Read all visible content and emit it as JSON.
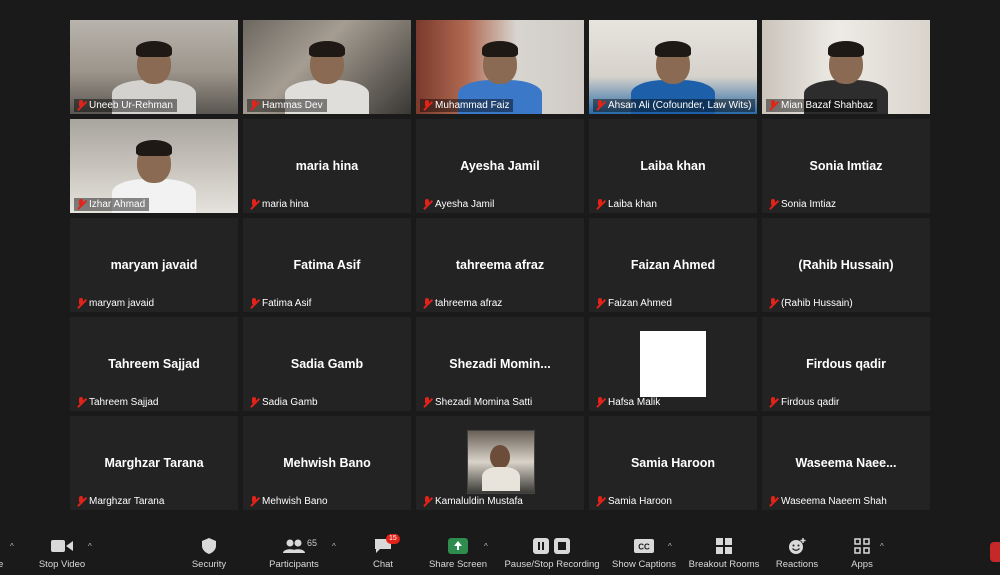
{
  "participants": [
    {
      "name": "Uneeb Ur-Rehman",
      "video": true,
      "bg": "bg-photo1",
      "shirt": "#d4d2cf"
    },
    {
      "name": "Hammas Dev",
      "video": true,
      "bg": "bg-photo2",
      "shirt": "#e0dedb"
    },
    {
      "name": "Muhammad Faiz",
      "video": true,
      "bg": "bg-photo3",
      "shirt": "#3c78c8"
    },
    {
      "name": "Ahsan Ali (Cofounder, Law Wits)",
      "video": true,
      "active": true,
      "bg": "bg-photo4",
      "shirt": "#1d5fa8"
    },
    {
      "name": "Mian Bazaf Shahbaz",
      "video": true,
      "bg": "bg-photo5",
      "shirt": "#2d2d2d"
    },
    {
      "name": "Izhar Ahmad",
      "video": true,
      "bg": "bg-photo6",
      "shirt": "#f2f2f2"
    },
    {
      "name": "maria hina",
      "display": "maria hina"
    },
    {
      "name": "Ayesha Jamil",
      "display": "Ayesha Jamil"
    },
    {
      "name": "Laiba khan",
      "display": "Laiba khan"
    },
    {
      "name": "Sonia Imtiaz",
      "display": "Sonia Imtiaz"
    },
    {
      "name": "maryam javaid",
      "display": "maryam javaid"
    },
    {
      "name": "Fatima Asif",
      "display": "Fatima Asif"
    },
    {
      "name": "tahreema afraz",
      "display": "tahreema afraz"
    },
    {
      "name": "Faizan Ahmed",
      "display": "Faizan Ahmed"
    },
    {
      "name": "(Rahib Hussain)",
      "display": "(Rahib Hussain)"
    },
    {
      "name": "Tahreem Sajjad",
      "display": "Tahreem Sajjad"
    },
    {
      "name": "Sadia Gamb",
      "display": "Sadia Gamb"
    },
    {
      "name": "Shezadi Momina Satti",
      "display": "Shezadi  Momin..."
    },
    {
      "name": "Hafsa Malik",
      "avatar": "white"
    },
    {
      "name": "Firdous qadir",
      "display": "Firdous qadir"
    },
    {
      "name": "Marghzar Tarana",
      "display": "Marghzar Tarana"
    },
    {
      "name": "Mehwish Bano",
      "display": "Mehwish Bano"
    },
    {
      "name": "Kamaluldin Mustafa",
      "avatar": "photo"
    },
    {
      "name": "Samia Haroon",
      "display": "Samia Haroon"
    },
    {
      "name": "Waseema Naeem Shah",
      "display": "Waseema  Naee..."
    }
  ],
  "toolbar": {
    "left_partial": "e",
    "stop_video": "Stop Video",
    "security": "Security",
    "participants": "Participants",
    "participants_count": "65",
    "chat": "Chat",
    "chat_badge": "15",
    "share_screen": "Share Screen",
    "recording": "Pause/Stop Recording",
    "captions": "Show Captions",
    "breakout": "Breakout Rooms",
    "reactions": "Reactions",
    "apps": "Apps"
  },
  "colors": {
    "accent_green": "#2d8c4e",
    "mute_red": "#e2231a",
    "active_border": "#d8e85a"
  }
}
